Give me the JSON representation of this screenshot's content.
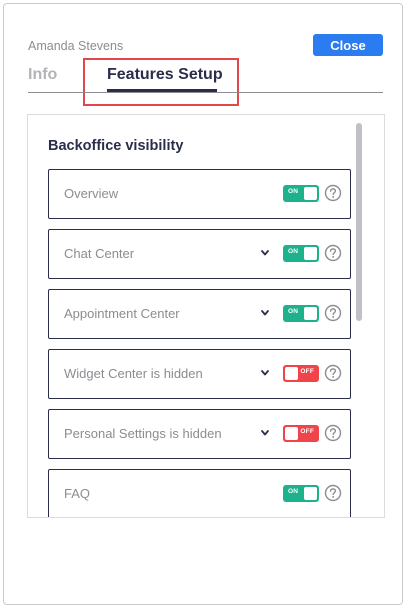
{
  "header": {
    "user_name": "Amanda Stevens",
    "close_label": "Close"
  },
  "tabs": [
    {
      "label": "Info",
      "active": false
    },
    {
      "label": "Features Setup",
      "active": true
    }
  ],
  "section": {
    "title": "Backoffice visibility"
  },
  "features": [
    {
      "label": "Overview",
      "expandable": false,
      "state": "on",
      "toggle_text": "ON",
      "help_icon": "question-circle-icon"
    },
    {
      "label": "Chat Center",
      "expandable": true,
      "state": "on",
      "toggle_text": "ON",
      "help_icon": "question-circle-icon"
    },
    {
      "label": "Appointment Center",
      "expandable": true,
      "state": "on",
      "toggle_text": "ON",
      "help_icon": "question-circle-icon"
    },
    {
      "label": "Widget Center is hidden",
      "expandable": true,
      "state": "off",
      "toggle_text": "OFF",
      "help_icon": "question-circle-icon"
    },
    {
      "label": "Personal Settings is hidden",
      "expandable": true,
      "state": "off",
      "toggle_text": "OFF",
      "help_icon": "question-circle-icon"
    },
    {
      "label": "FAQ",
      "expandable": false,
      "state": "on",
      "toggle_text": "ON",
      "help_icon": "question-circle-icon"
    }
  ],
  "colors": {
    "accent": "#2b7cf0",
    "toggle_on": "#1db28b",
    "toggle_off": "#f0444a",
    "tab_active": "#2b2e4a",
    "highlight": "#e2474c"
  }
}
